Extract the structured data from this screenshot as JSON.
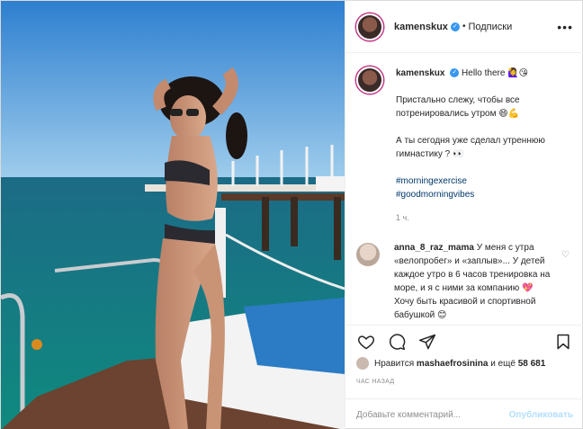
{
  "post": {
    "username": "kamenskux",
    "verified_mark": "✓",
    "header_sep": "•",
    "follow_label": "Подписки",
    "more_label": "•••",
    "caption": {
      "greeting": "Hello there 🙋‍♀️😘",
      "line1": "Пристально слежу, чтобы все потренировались утром 😄💪",
      "line2": "А ты сегодня уже сделал утреннюю гимнастику ? 👀",
      "tag1": "#morningexercise",
      "tag2": "#goodmorningvibes",
      "time": "1 ч."
    },
    "comment": {
      "username": "anna_8_raz_mama",
      "text": "У меня с утра «велопробег» и «заплыв»... У детей каждое утро в 6 часов тренировка на море, и я с ними за компанию 💖",
      "text2": "Хочу быть красивой и спортивной бабушкой 😊"
    },
    "likes": {
      "prefix": "Нравится",
      "user": "mashaefrosinina",
      "middle": "и ещё",
      "count": "58 681"
    },
    "timestamp": "ЧАС НАЗАД",
    "comment_input": {
      "placeholder": "Добавьте комментарий...",
      "publish_label": "Опубликовать"
    },
    "icons": {
      "like": "heart-icon",
      "comment": "comment-icon",
      "share": "share-icon",
      "save": "bookmark-icon"
    }
  }
}
